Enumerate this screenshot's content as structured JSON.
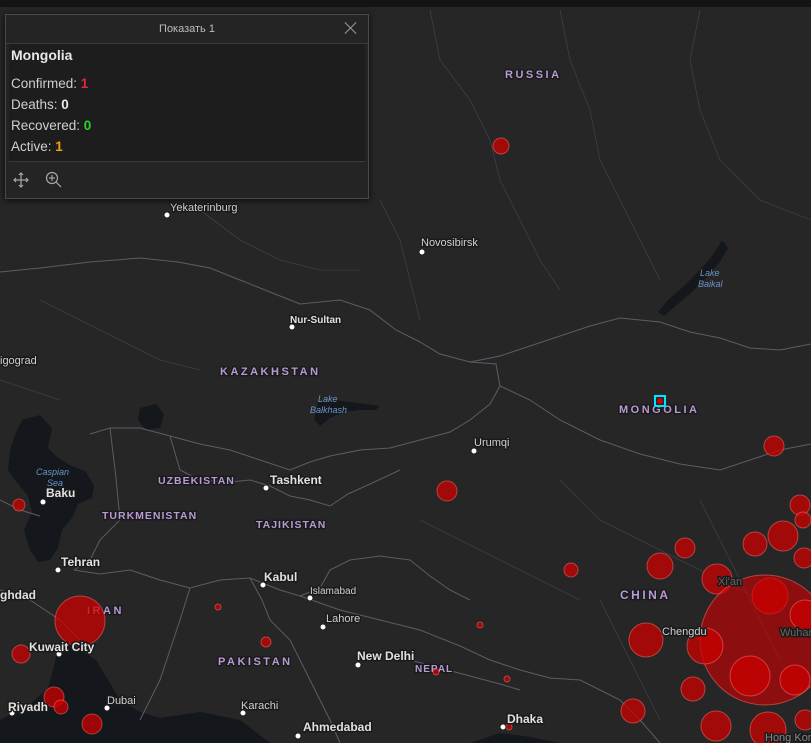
{
  "popup": {
    "header": "Показать 1",
    "title": "Mongolia",
    "stats": [
      {
        "label": "Confirmed: ",
        "value": "1",
        "color": "#e8263b"
      },
      {
        "label": "Deaths: ",
        "value": "0",
        "color": "#eaeaea"
      },
      {
        "label": "Recovered: ",
        "value": "0",
        "color": "#2bd22b"
      },
      {
        "label": "Active: ",
        "value": "1",
        "color": "#f0a010"
      }
    ],
    "footer_icons": [
      "pan-icon",
      "zoom-in-icon"
    ]
  },
  "countries": [
    "RUSSIA",
    "KAZAKHSTAN",
    "MONGOLIA",
    "UZBEKISTAN",
    "TURKMENISTAN",
    "TAJIKISTAN",
    "IRAN",
    "PAKISTAN",
    "CHINA",
    "NEPAL"
  ],
  "cities": [
    "Yekaterinburg",
    "Novosibirsk",
    "Nur-Sultan",
    "Urumqi",
    "Tashkent",
    "Baku",
    "Tehran",
    "Kabul",
    "Islamabad",
    "Lahore",
    "New Delhi",
    "Karachi",
    "Ahmedabad",
    "Dubai",
    "Riyadh",
    "Kuwait City",
    "Dhaka",
    "Chengdu",
    "Xi'an",
    "Wuhan",
    "Hong Kong",
    "igograd",
    "ghdad"
  ],
  "lakes": [
    "Lake",
    "Baikal",
    "Lake",
    "Balkhash",
    "Caspian",
    "Sea"
  ],
  "colors": {
    "map_background": "#262626",
    "water": "#14171c",
    "borders": "#5a5a66",
    "bubble": "#cc0000",
    "country_label": "#b89ad4",
    "selection": "#00e5ff"
  }
}
